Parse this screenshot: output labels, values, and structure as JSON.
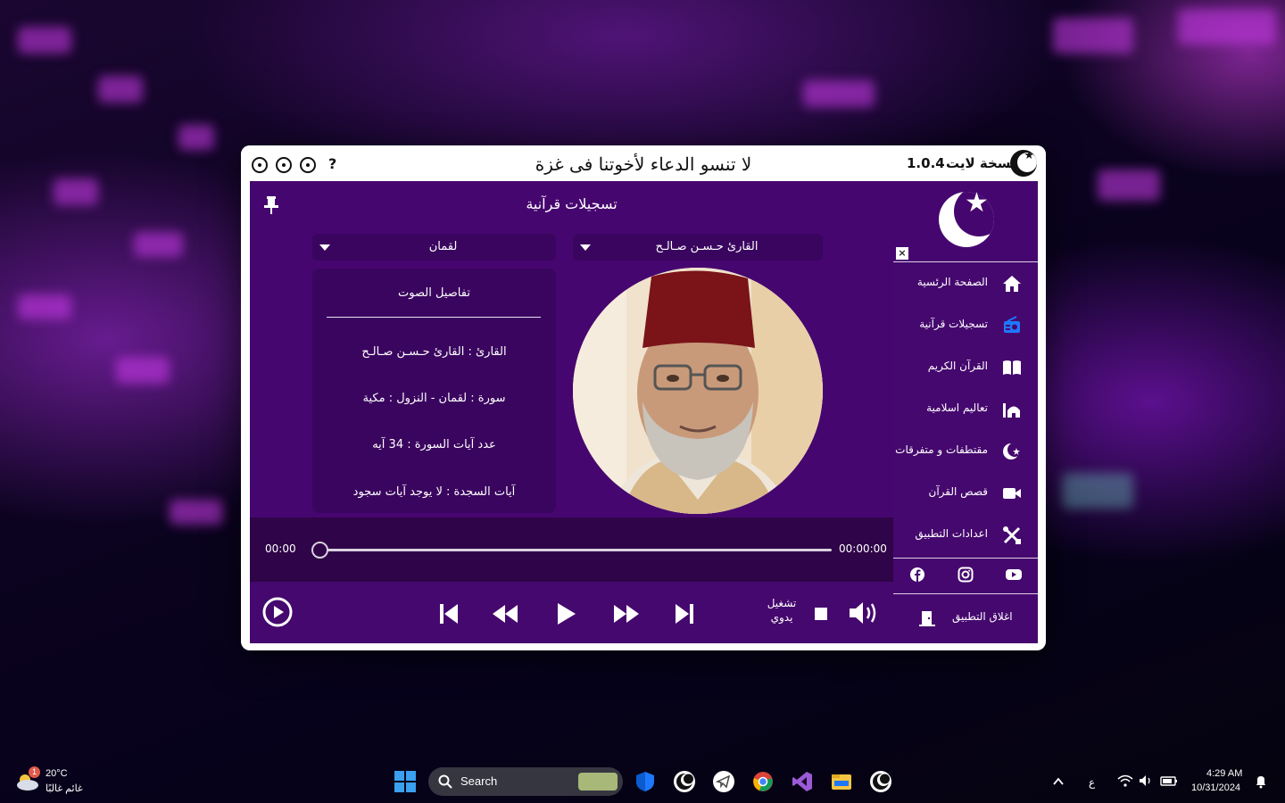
{
  "window": {
    "title": "لا تنسو الدعاء لأخوتنا فى غزة",
    "version": "1.0.4",
    "edition": "نسخة لايت",
    "help": "?"
  },
  "page": {
    "title": "تسجيلات قرآنية"
  },
  "dropdowns": {
    "reciter": "القارئ حـسـن صـالـح",
    "surah": "لقمان"
  },
  "details": {
    "title": "تفاصيل الصوت",
    "reciter_row": "القارئ : القارئ حـسـن صـالـح",
    "surah_row": "سورة  :  لقمان  -  النزول  :  مكية",
    "verses_row": "عدد آيات السورة :  34  آيه",
    "sajda_row": "آيات السجدة  :  لا يوجد آيات سجود"
  },
  "player": {
    "elapsed": "00:00",
    "duration": "00:00:00",
    "progress": 0,
    "auto_label_1": "تشغيل",
    "auto_label_2": "يدوي"
  },
  "sidebar": {
    "close": "×",
    "items": [
      {
        "label": "الصفحة الرئسية",
        "icon": "home-icon"
      },
      {
        "label": "تسجيلات قرآنية",
        "icon": "radio-icon"
      },
      {
        "label": "القرآن الكريم",
        "icon": "book-icon"
      },
      {
        "label": "تعاليم اسلامية",
        "icon": "mosque-icon"
      },
      {
        "label": "مقتطفات و متفرقات",
        "icon": "crescent-star-icon"
      },
      {
        "label": "قصص القرآن",
        "icon": "video-camera-icon"
      },
      {
        "label": "اعدادات التطبيق",
        "icon": "tools-icon"
      }
    ],
    "exit_label": "اغلاق التطبيق"
  },
  "taskbar": {
    "search": "Search",
    "weather_temp": "20°C",
    "weather_desc": "غائم غالبًا",
    "weather_badge": "1",
    "time": "4:29 AM",
    "date": "10/31/2024",
    "lang": "ع"
  },
  "colors": {
    "panel": "#46066f",
    "panel_dark": "#3a055f",
    "seek_bg": "#2f0448",
    "accent_blue": "#1e78ff"
  }
}
